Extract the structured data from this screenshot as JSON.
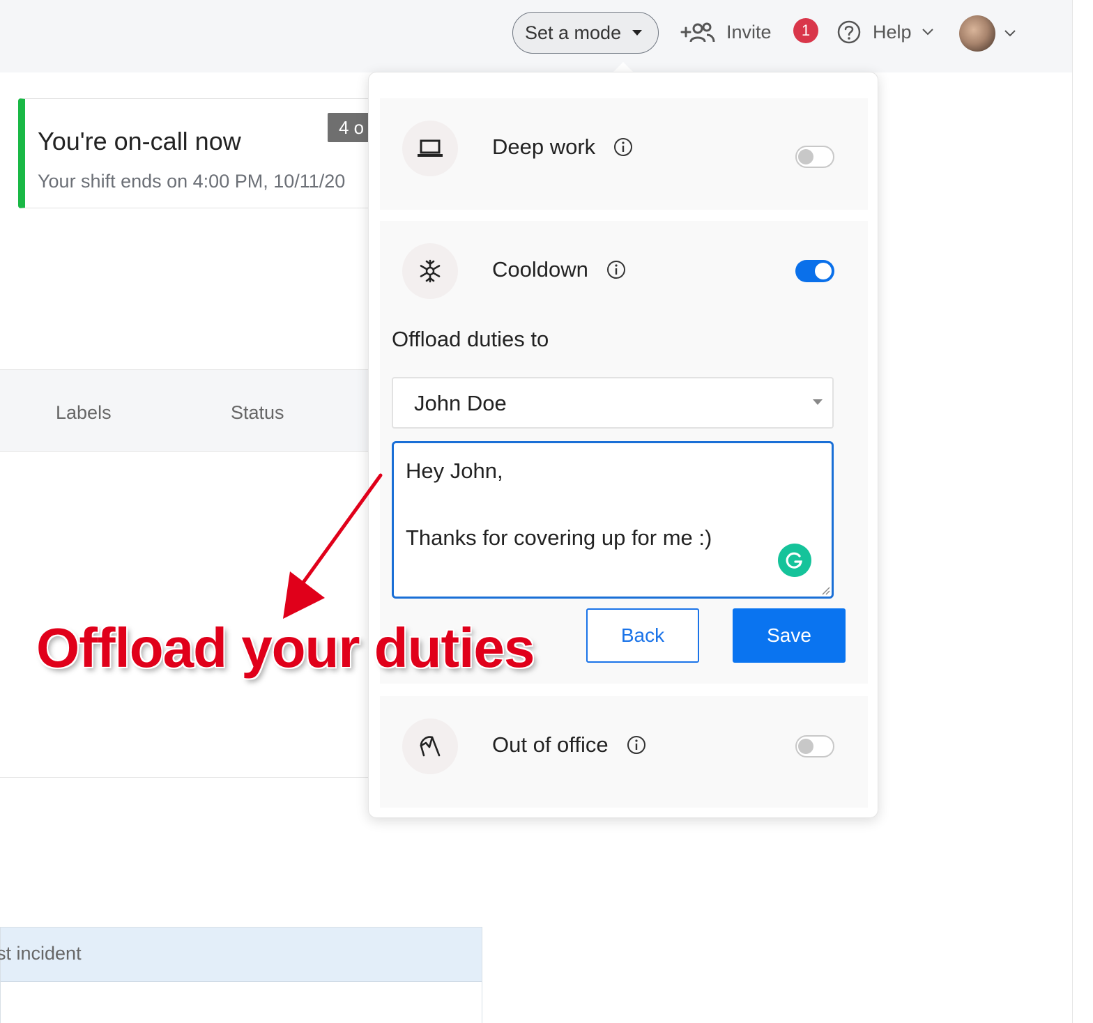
{
  "topbar": {
    "mode_button": "Set a mode",
    "invite_label": "Invite",
    "notification_count": "1",
    "help_label": "Help"
  },
  "oncall": {
    "title": "You're on-call now",
    "subtitle": "Your shift ends on 4:00 PM, 10/11/20",
    "count_chip": "4 o",
    "status_color": "#19b845"
  },
  "table": {
    "headers": [
      "Labels",
      "Status"
    ]
  },
  "incident": {
    "header": "st incident"
  },
  "modes": {
    "deep_work": {
      "label": "Deep work",
      "enabled": false,
      "icon": "laptop-icon"
    },
    "cooldown": {
      "label": "Cooldown",
      "enabled": true,
      "icon": "snowflake-icon",
      "offload_label": "Offload duties to",
      "selected_user": "John Doe",
      "message_lines": [
        "Hey John,",
        "",
        "Thanks for covering up for me :)"
      ],
      "back_label": "Back",
      "save_label": "Save"
    },
    "out_of_office": {
      "label": "Out of office",
      "enabled": false,
      "icon": "umbrella-icon"
    }
  },
  "annotation": {
    "text": "Offload your duties",
    "color": "#e0001a"
  },
  "colors": {
    "accent": "#0a74f0",
    "toggle_on": "#0a70ea",
    "badge": "#d9364a",
    "grammarly": "#15c39a"
  }
}
